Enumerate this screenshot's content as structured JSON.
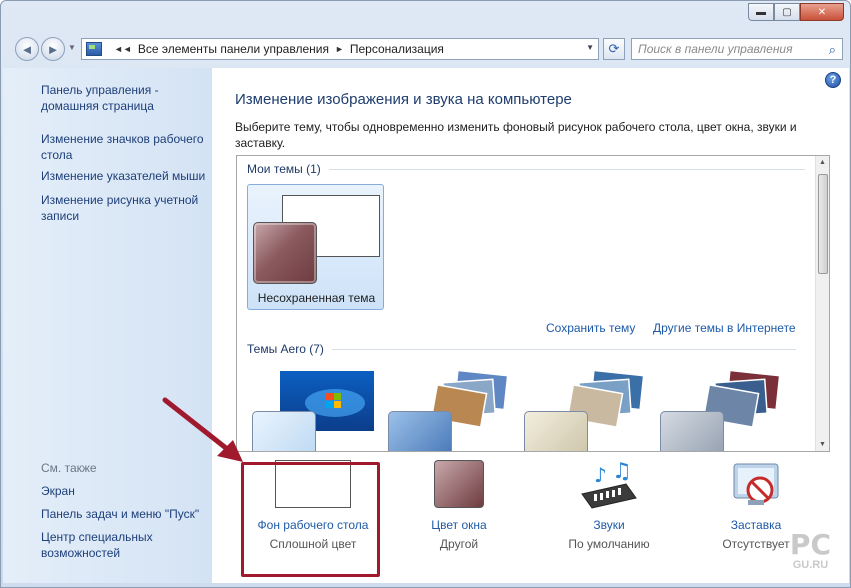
{
  "window": {
    "caption": {
      "min": "▬",
      "max": "▢",
      "close": "✕"
    }
  },
  "nav": {
    "back_icon": "◄",
    "forward_icon": "►",
    "breadcrumbs": [
      "Все элементы панели управления",
      "Персонализация"
    ],
    "sep": "►",
    "search_placeholder": "Поиск в панели управления",
    "search_icon": "⌕",
    "refresh_icon": "⟳"
  },
  "sidebar": {
    "home_link": "Панель управления - домашняя страница",
    "links": [
      "Изменение значков рабочего стола",
      "Изменение указателей мыши",
      "Изменение рисунка учетной записи"
    ],
    "see_also_label": "См. также",
    "see_also": [
      "Экран",
      "Панель задач и меню \"Пуск\"",
      "Центр специальных возможностей"
    ]
  },
  "help_icon": "?",
  "main": {
    "title": "Изменение изображения и звука на компьютере",
    "description": "Выберите тему, чтобы одновременно изменить фоновый рисунок рабочего стола, цвет окна, звуки и заставку."
  },
  "themes": {
    "my_themes_header": "Мои темы (1)",
    "selected_theme_name": "Несохраненная тема",
    "save_link": "Сохранить тему",
    "more_link": "Другие темы в Интернете",
    "aero_header": "Темы Aero (7)"
  },
  "options": [
    {
      "title": "Фон рабочего стола",
      "subtitle": "Сплошной цвет"
    },
    {
      "title": "Цвет окна",
      "subtitle": "Другой"
    },
    {
      "title": "Звуки",
      "subtitle": "По умолчанию"
    },
    {
      "title": "Заставка",
      "subtitle": "Отсутствует"
    }
  ],
  "watermark": {
    "big": "PC",
    "small": "GU.RU"
  },
  "colors": {
    "highlight": "#a0192d",
    "link": "#1e5aa8"
  }
}
